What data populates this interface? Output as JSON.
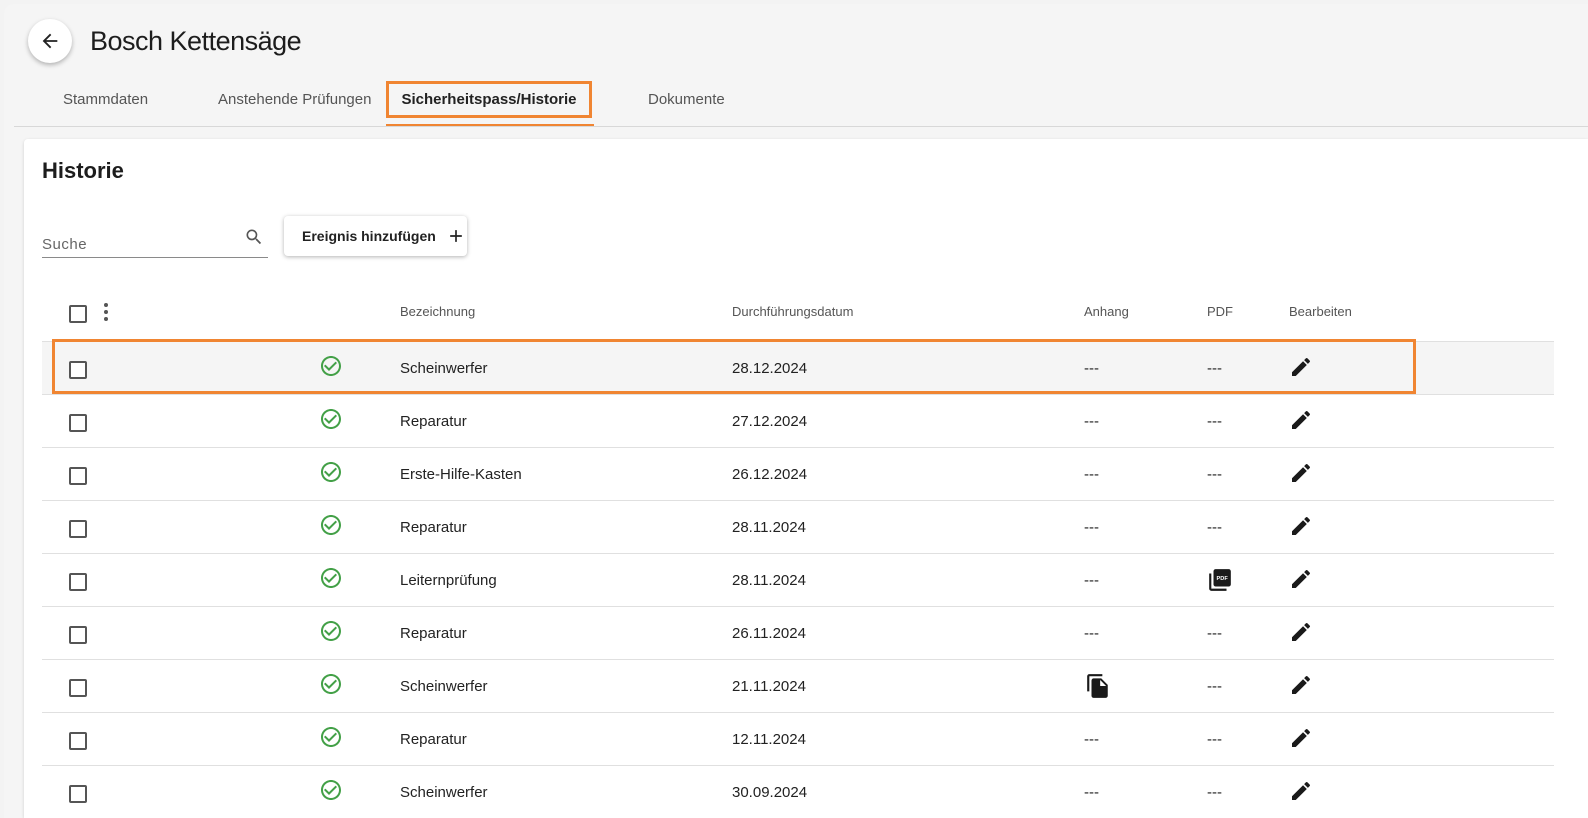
{
  "header": {
    "title": "Bosch Kettensäge"
  },
  "tabs": [
    {
      "label": "Stammdaten"
    },
    {
      "label": "Anstehende Prüfungen"
    },
    {
      "label": "Sicherheitspass/Historie"
    },
    {
      "label": "Dokumente"
    }
  ],
  "active_tab": "Sicherheitspass/Historie",
  "colors": {
    "accent": "#f08532",
    "status_ok": "#43a047"
  },
  "section": {
    "title": "Historie",
    "search_placeholder": "Suche",
    "add_button_label": "Ereignis hinzufügen"
  },
  "table": {
    "columns": {
      "bezeichnung": "Bezeichnung",
      "datum": "Durchführungsdatum",
      "anhang": "Anhang",
      "pdf": "PDF",
      "bearbeiten": "Bearbeiten"
    },
    "rows": [
      {
        "status": "check-circle-icon",
        "bezeichnung": "Scheinwerfer",
        "datum": "28.12.2024",
        "anhang": "---",
        "pdf": "---",
        "selected": true
      },
      {
        "status": "check-circle-icon",
        "bezeichnung": "Reparatur",
        "datum": "27.12.2024",
        "anhang": "---",
        "pdf": "---"
      },
      {
        "status": "check-circle-icon",
        "bezeichnung": "Erste-Hilfe-Kasten",
        "datum": "26.12.2024",
        "anhang": "---",
        "pdf": "---"
      },
      {
        "status": "check-circle-icon",
        "bezeichnung": "Reparatur",
        "datum": "28.11.2024",
        "anhang": "---",
        "pdf": "---"
      },
      {
        "status": "check-circle-icon",
        "bezeichnung": "Leiternprüfung",
        "datum": "28.11.2024",
        "anhang": "---",
        "pdf": "pdf-file-icon"
      },
      {
        "status": "check-circle-icon",
        "bezeichnung": "Reparatur",
        "datum": "26.11.2024",
        "anhang": "---",
        "pdf": "---"
      },
      {
        "status": "check-circle-icon",
        "bezeichnung": "Scheinwerfer",
        "datum": "21.11.2024",
        "anhang": "attachment-file-icon",
        "pdf": "---"
      },
      {
        "status": "check-circle-icon",
        "bezeichnung": "Reparatur",
        "datum": "12.11.2024",
        "anhang": "---",
        "pdf": "---"
      },
      {
        "status": "check-circle-icon",
        "bezeichnung": "Scheinwerfer",
        "datum": "30.09.2024",
        "anhang": "---",
        "pdf": "---"
      }
    ]
  }
}
